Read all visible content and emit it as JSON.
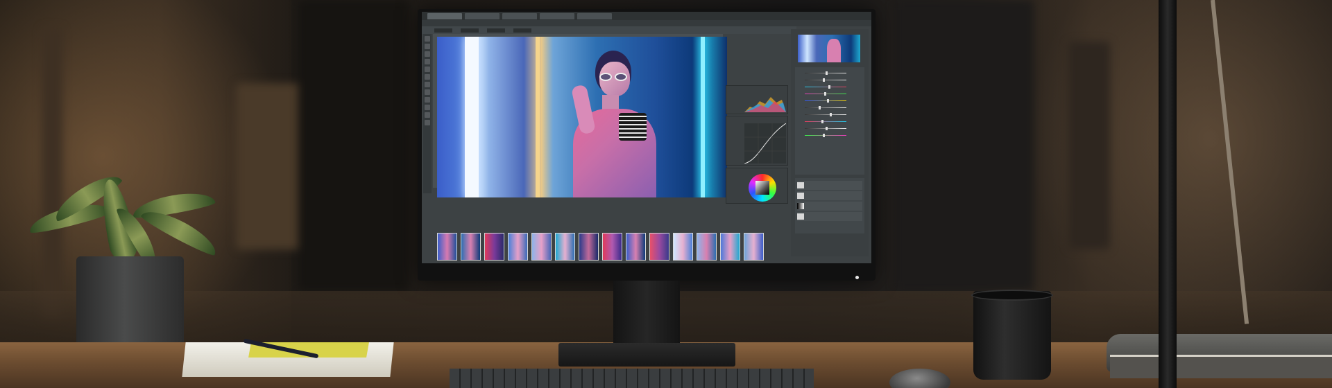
{
  "scene": {
    "description_icons": {
      "plant": "plant-icon",
      "mug": "mug-icon",
      "lamp": "lamp-icon",
      "keyboard": "keyboard-icon",
      "mouse": "mouse-icon"
    }
  },
  "app": {
    "tabs": [
      "",
      "",
      "",
      "",
      ""
    ],
    "menu": [
      "",
      "",
      "",
      "",
      "",
      "",
      "",
      "",
      "",
      ""
    ],
    "options": [
      "",
      "",
      "",
      "",
      "",
      ""
    ],
    "panels": {
      "histogram": "",
      "curves": "",
      "color": "",
      "adjustments": "",
      "layers": ""
    },
    "layers": [
      "",
      "",
      "",
      ""
    ],
    "filmstrip_label": "",
    "colors": {
      "accent_blue": "#4d79d8",
      "neon_cyan": "#1ea8d0",
      "neon_white": "#cfe6ff",
      "ui_dark": "#3a3f41"
    }
  }
}
